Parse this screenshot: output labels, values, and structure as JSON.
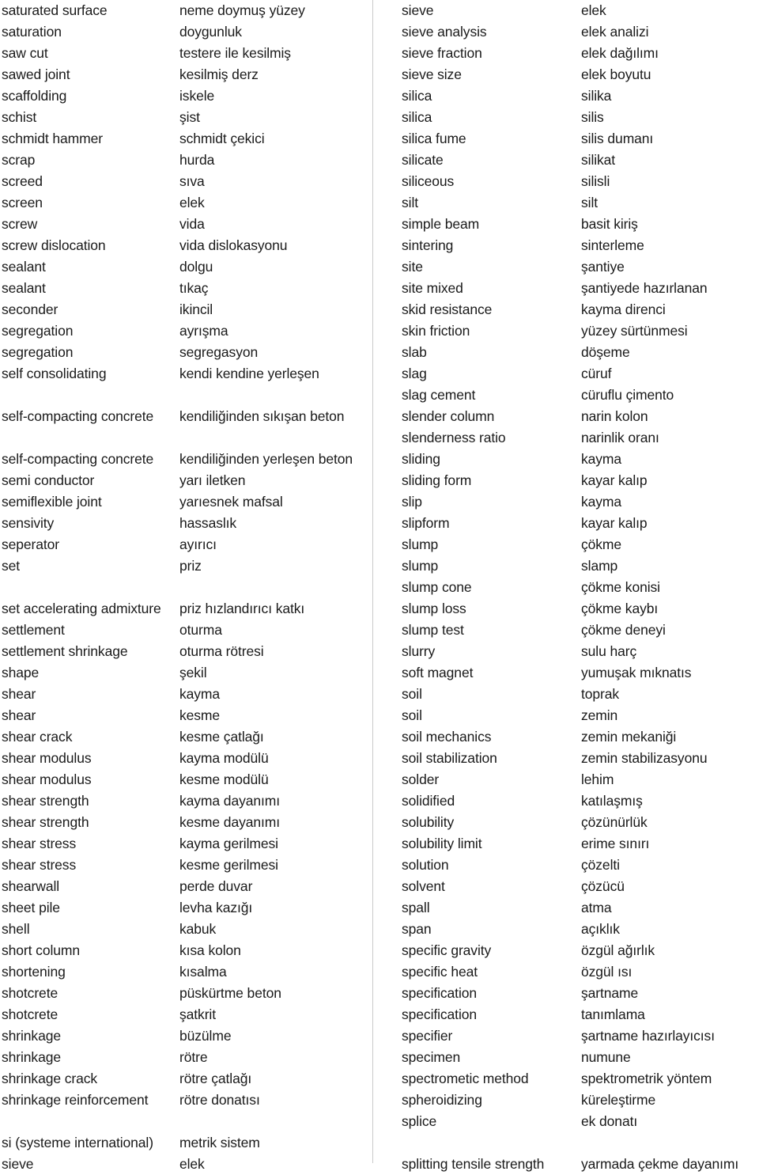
{
  "document": {
    "type": "english-turkish-technical-glossary",
    "divider_color": "#c9c9c9",
    "text_color": "#1a1a1a",
    "background_color": "#ffffff"
  },
  "columns": [
    {
      "id": "left",
      "entries": [
        {
          "en": "saturated surface",
          "tr": "neme doymuş yüzey"
        },
        {
          "en": "saturation",
          "tr": "doygunluk"
        },
        {
          "en": "saw cut",
          "tr": "testere ile kesilmiş"
        },
        {
          "en": "sawed joint",
          "tr": "kesilmiş derz"
        },
        {
          "en": "scaffolding",
          "tr": "iskele"
        },
        {
          "en": "schist",
          "tr": "şist"
        },
        {
          "en": "schmidt hammer",
          "tr": "schmidt çekici"
        },
        {
          "en": "scrap",
          "tr": "hurda"
        },
        {
          "en": "screed",
          "tr": "sıva"
        },
        {
          "en": "screen",
          "tr": "elek"
        },
        {
          "en": "screw",
          "tr": "vida"
        },
        {
          "en": "screw dislocation",
          "tr": "vida dislokasyonu"
        },
        {
          "en": "sealant",
          "tr": "dolgu"
        },
        {
          "en": "sealant",
          "tr": "tıkaç"
        },
        {
          "en": "seconder",
          "tr": "ikincil"
        },
        {
          "en": "segregation",
          "tr": "ayrışma"
        },
        {
          "en": "segregation",
          "tr": "segregasyon"
        },
        {
          "en": "self consolidating",
          "tr": "kendi kendine yerleşen"
        },
        {
          "en": "self-compacting concrete",
          "tr": "kendiliğinden sıkışan beton",
          "wrap": true
        },
        {
          "en": "self-compacting concrete",
          "tr": "kendiliğinden yerleşen beton",
          "wrap": true
        },
        {
          "en": "semi conductor",
          "tr": "yarı iletken"
        },
        {
          "en": "semiflexible joint",
          "tr": "yarıesnek mafsal"
        },
        {
          "en": "sensivity",
          "tr": "hassaslık"
        },
        {
          "en": "seperator",
          "tr": "ayırıcı"
        },
        {
          "en": "set",
          "tr": "priz"
        },
        {
          "en": "",
          "tr": "",
          "spacer": true
        },
        {
          "en": "set accelerating admixture",
          "tr": "priz hızlandırıcı katkı"
        },
        {
          "en": "settlement",
          "tr": "oturma"
        },
        {
          "en": "settlement shrinkage",
          "tr": "oturma rötresi"
        },
        {
          "en": "shape",
          "tr": "şekil"
        },
        {
          "en": "shear",
          "tr": "kayma"
        },
        {
          "en": "shear",
          "tr": "kesme"
        },
        {
          "en": "shear crack",
          "tr": "kesme çatlağı"
        },
        {
          "en": "shear modulus",
          "tr": "kayma modülü"
        },
        {
          "en": "shear modulus",
          "tr": "kesme modülü"
        },
        {
          "en": "shear strength",
          "tr": "kayma dayanımı"
        },
        {
          "en": "shear strength",
          "tr": "kesme dayanımı"
        },
        {
          "en": "shear stress",
          "tr": "kayma gerilmesi"
        },
        {
          "en": "shear stress",
          "tr": "kesme gerilmesi"
        },
        {
          "en": "shearwall",
          "tr": "perde duvar"
        },
        {
          "en": "sheet pile",
          "tr": "levha kazığı"
        },
        {
          "en": "shell",
          "tr": "kabuk"
        },
        {
          "en": "short column",
          "tr": "kısa kolon"
        },
        {
          "en": "shortening",
          "tr": "kısalma"
        },
        {
          "en": "shotcrete",
          "tr": "püskürtme beton"
        },
        {
          "en": "shotcrete",
          "tr": "şatkrit"
        },
        {
          "en": "shrinkage",
          "tr": "büzülme"
        },
        {
          "en": "shrinkage",
          "tr": "rötre"
        },
        {
          "en": "shrinkage crack",
          "tr": "rötre çatlağı"
        },
        {
          "en": "shrinkage reinforcement",
          "tr": "rötre donatısı"
        },
        {
          "en": "",
          "tr": "",
          "spacer": true
        },
        {
          "en": "si (systeme international)",
          "tr": "metrik sistem"
        },
        {
          "en": "sieve",
          "tr": "elek"
        }
      ]
    },
    {
      "id": "right",
      "entries": [
        {
          "en": "sieve",
          "tr": "elek"
        },
        {
          "en": "sieve analysis",
          "tr": "elek analizi"
        },
        {
          "en": "sieve fraction",
          "tr": "elek dağılımı"
        },
        {
          "en": "sieve size",
          "tr": "elek boyutu"
        },
        {
          "en": "silica",
          "tr": "silika"
        },
        {
          "en": "silica",
          "tr": "silis"
        },
        {
          "en": "silica fume",
          "tr": "silis dumanı"
        },
        {
          "en": "silicate",
          "tr": "silikat"
        },
        {
          "en": "siliceous",
          "tr": "silisli"
        },
        {
          "en": "silt",
          "tr": "silt"
        },
        {
          "en": "simple beam",
          "tr": "basit kiriş"
        },
        {
          "en": "sintering",
          "tr": "sinterleme"
        },
        {
          "en": "site",
          "tr": "şantiye"
        },
        {
          "en": "site mixed",
          "tr": "şantiyede hazırlanan"
        },
        {
          "en": "skid resistance",
          "tr": "kayma direnci"
        },
        {
          "en": "skin friction",
          "tr": "yüzey sürtünmesi"
        },
        {
          "en": "slab",
          "tr": "döşeme"
        },
        {
          "en": "slag",
          "tr": "cüruf"
        },
        {
          "en": "slag cement",
          "tr": "cüruflu çimento"
        },
        {
          "en": "slender column",
          "tr": "narin kolon"
        },
        {
          "en": "slenderness ratio",
          "tr": "narinlik oranı"
        },
        {
          "en": "sliding",
          "tr": "kayma"
        },
        {
          "en": "sliding form",
          "tr": "kayar kalıp"
        },
        {
          "en": "slip",
          "tr": "kayma"
        },
        {
          "en": "slipform",
          "tr": "kayar kalıp"
        },
        {
          "en": "slump",
          "tr": "çökme"
        },
        {
          "en": "slump",
          "tr": "slamp"
        },
        {
          "en": "slump cone",
          "tr": "çökme konisi"
        },
        {
          "en": "slump loss",
          "tr": "çökme kaybı"
        },
        {
          "en": "slump test",
          "tr": "çökme deneyi"
        },
        {
          "en": "slurry",
          "tr": "sulu harç"
        },
        {
          "en": "soft magnet",
          "tr": "yumuşak mıknatıs"
        },
        {
          "en": "soil",
          "tr": "toprak"
        },
        {
          "en": "soil",
          "tr": "zemin"
        },
        {
          "en": "soil mechanics",
          "tr": "zemin mekaniği"
        },
        {
          "en": "soil stabilization",
          "tr": "zemin stabilizasyonu"
        },
        {
          "en": "solder",
          "tr": "lehim"
        },
        {
          "en": "solidified",
          "tr": "katılaşmış"
        },
        {
          "en": "solubility",
          "tr": "çözünürlük"
        },
        {
          "en": "solubility limit",
          "tr": "erime sınırı"
        },
        {
          "en": "solution",
          "tr": "çözelti"
        },
        {
          "en": "solvent",
          "tr": "çözücü"
        },
        {
          "en": "spall",
          "tr": "atma"
        },
        {
          "en": "span",
          "tr": "açıklık"
        },
        {
          "en": "specific gravity",
          "tr": "özgül ağırlık"
        },
        {
          "en": "specific heat",
          "tr": "özgül ısı"
        },
        {
          "en": "specification",
          "tr": "şartname"
        },
        {
          "en": "specification",
          "tr": "tanımlama"
        },
        {
          "en": "specifier",
          "tr": "şartname hazırlayıcısı"
        },
        {
          "en": "specimen",
          "tr": "numune"
        },
        {
          "en": "spectrometic method",
          "tr": "spektrometrik yöntem"
        },
        {
          "en": "spheroidizing",
          "tr": "küreleştirme"
        },
        {
          "en": "splice",
          "tr": "ek donatı"
        },
        {
          "en": "",
          "tr": "",
          "spacer": true
        },
        {
          "en": "splitting tensile strength",
          "tr": "yarmada çekme dayanımı"
        }
      ]
    }
  ]
}
